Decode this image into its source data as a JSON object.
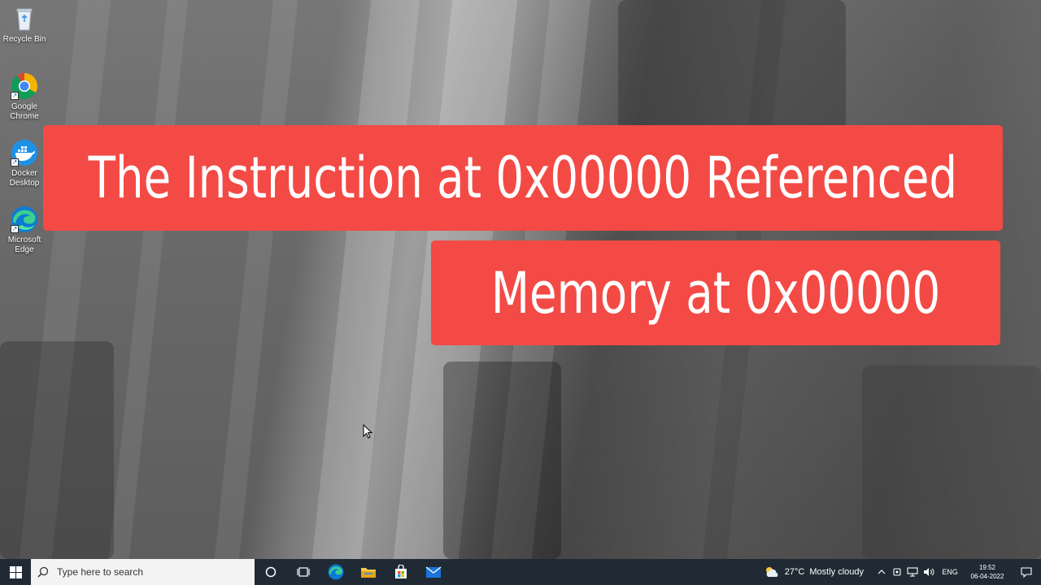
{
  "desktop_icons": [
    {
      "label": "Recycle Bin",
      "icon": "recycle-bin-icon"
    },
    {
      "label": "Google Chrome",
      "icon": "chrome-icon"
    },
    {
      "label": "Docker Desktop",
      "icon": "docker-icon"
    },
    {
      "label": "Microsoft Edge",
      "icon": "edge-icon"
    }
  ],
  "banner": {
    "line1": "The Instruction at 0x00000 Referenced",
    "line2": "Memory at 0x00000"
  },
  "taskbar": {
    "search_placeholder": "Type here to search",
    "weather_temp": "27°C",
    "weather_desc": "Mostly cloudy",
    "language": "ENG",
    "time": "19:52",
    "date": "06-04-2022"
  },
  "colors": {
    "banner": "#f34a45",
    "taskbar": "#1f2a35"
  }
}
